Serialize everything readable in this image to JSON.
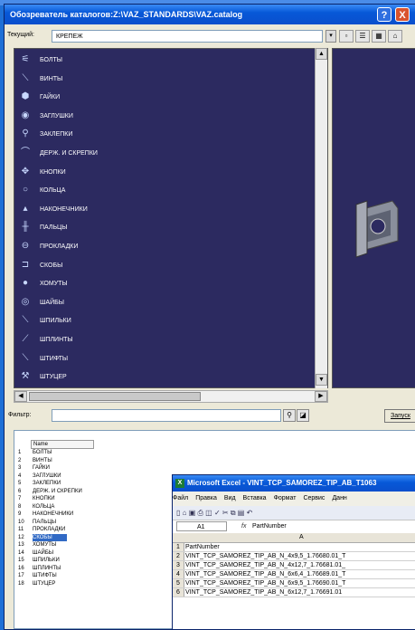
{
  "window": {
    "title": "Обозреватель каталогов:Z:\\VAZ_STANDARDS\\VAZ.catalog",
    "help_btn": "?",
    "close_btn": "X"
  },
  "current": {
    "label": "Текущий:",
    "value": "КРЕПЕЖ"
  },
  "catalog_items": [
    {
      "label": "БОЛТЫ",
      "icon": "bolt-icon",
      "glyph": "⚟"
    },
    {
      "label": "ВИНТЫ",
      "icon": "screw-icon",
      "glyph": "⟍"
    },
    {
      "label": "ГАЙКИ",
      "icon": "nut-icon",
      "glyph": "⬢"
    },
    {
      "label": "ЗАГЛУШКИ",
      "icon": "plug-icon",
      "glyph": "◉"
    },
    {
      "label": "ЗАКЛЕПКИ",
      "icon": "rivet-icon",
      "glyph": "⚲"
    },
    {
      "label": "ДЕРЖ. И СКРЕПКИ",
      "icon": "clip-icon",
      "glyph": "⌒"
    },
    {
      "label": "КНОПКИ",
      "icon": "button-fastener-icon",
      "glyph": "✥"
    },
    {
      "label": "КОЛЬЦА",
      "icon": "ring-icon",
      "glyph": "○"
    },
    {
      "label": "НАКОНЕЧНИКИ",
      "icon": "tip-icon",
      "glyph": "▴"
    },
    {
      "label": "ПАЛЬЦЫ",
      "icon": "pin-icon",
      "glyph": "╫"
    },
    {
      "label": "ПРОКЛАДКИ",
      "icon": "gasket-icon",
      "glyph": "⊖"
    },
    {
      "label": "СКОБЫ",
      "icon": "bracket-icon",
      "glyph": "⊐"
    },
    {
      "label": "ХОМУТЫ",
      "icon": "clamp-icon",
      "glyph": "●"
    },
    {
      "label": "ШАЙБЫ",
      "icon": "washer-icon",
      "glyph": "◎"
    },
    {
      "label": "ШПИЛЬКИ",
      "icon": "stud-icon",
      "glyph": "⟍"
    },
    {
      "label": "ШПЛИНТЫ",
      "icon": "cotter-icon",
      "glyph": "⟋"
    },
    {
      "label": "ШТИФТЫ",
      "icon": "dowel-icon",
      "glyph": "⟍"
    },
    {
      "label": "ШТУЦЕР",
      "icon": "fitting-icon",
      "glyph": "⚒"
    }
  ],
  "filter": {
    "label": "Фильтр:",
    "value": "",
    "query_button": "Запуск"
  },
  "table": {
    "column": "Name",
    "selected_index": 11,
    "rows": [
      {
        "n": "1",
        "name": "БОЛТЫ"
      },
      {
        "n": "2",
        "name": "ВИНТЫ"
      },
      {
        "n": "3",
        "name": "ГАЙКИ"
      },
      {
        "n": "4",
        "name": "ЗАГЛУШКИ"
      },
      {
        "n": "5",
        "name": "ЗАКЛЕПКИ"
      },
      {
        "n": "6",
        "name": "ДЕРЖ. И СКРЕПКИ"
      },
      {
        "n": "7",
        "name": "КНОПКИ"
      },
      {
        "n": "8",
        "name": "КОЛЬЦА"
      },
      {
        "n": "9",
        "name": "НАКОНЕЧНИКИ"
      },
      {
        "n": "10",
        "name": "ПАЛЬЦЫ"
      },
      {
        "n": "11",
        "name": "ПРОКЛАДКИ"
      },
      {
        "n": "12",
        "name": "СКОБЫ"
      },
      {
        "n": "13",
        "name": "ХОМУТЫ"
      },
      {
        "n": "14",
        "name": "ШАЙБЫ"
      },
      {
        "n": "15",
        "name": "ШПИЛЬКИ"
      },
      {
        "n": "16",
        "name": "ШПЛИНТЫ"
      },
      {
        "n": "17",
        "name": "ШТИФТЫ"
      },
      {
        "n": "18",
        "name": "ШТУЦЕР"
      }
    ]
  },
  "excel": {
    "title": "Microsoft Excel - VINT_TCP_SAMOREZ_TIP_AB_T1063",
    "menu": [
      "Файл",
      "Правка",
      "Вид",
      "Вставка",
      "Формат",
      "Сервис",
      "Данн"
    ],
    "namebox": "A1",
    "fx": "fx",
    "formula": "PartNumber",
    "col": "A",
    "rows": [
      {
        "n": "1",
        "v": "PartNumber"
      },
      {
        "n": "2",
        "v": "VINT_TCP_SAMOREZ_TIP_AB_N_4x9,5_1.76680.01_T"
      },
      {
        "n": "3",
        "v": "VINT_TCP_SAMOREZ_TIP_AB_N_4x12,7_1.76681.01_"
      },
      {
        "n": "4",
        "v": "VINT_TCP_SAMOREZ_TIP_AB_N_6x6,4_1.76689.01_T"
      },
      {
        "n": "5",
        "v": "VINT_TCP_SAMOREZ_TIP_AB_N_6x9,5_1.76690.01_T"
      },
      {
        "n": "6",
        "v": "VINT_TCP_SAMOREZ_TIP_AB_N_6x12,7_1.76691.01"
      }
    ]
  }
}
